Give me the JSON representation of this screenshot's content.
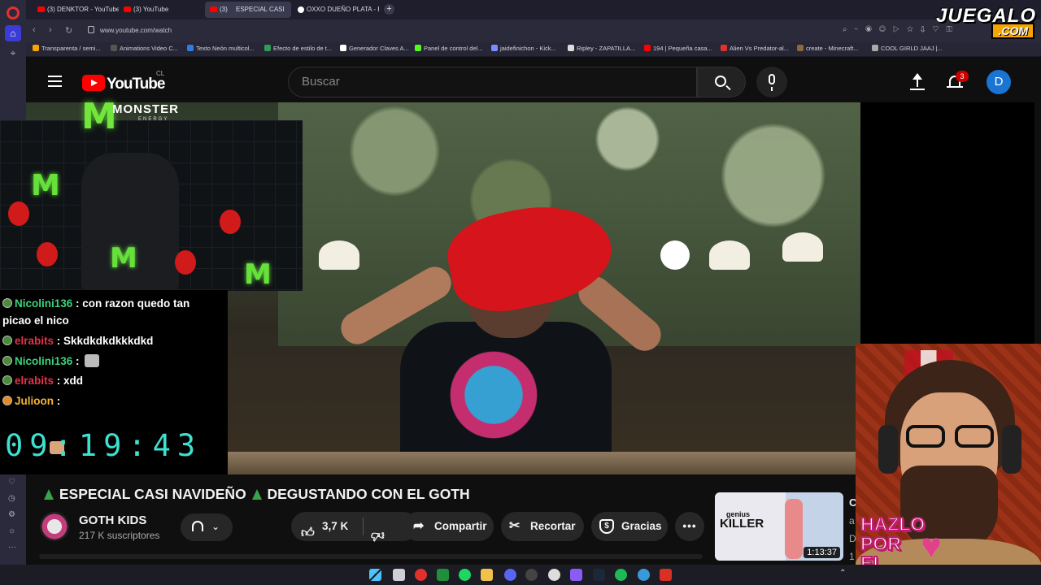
{
  "browser": {
    "tabs": [
      {
        "label": "(3) DENKTOR - YouTube",
        "active": false,
        "favicon": "youtube-icon"
      },
      {
        "label": "(3) YouTube",
        "active": false,
        "favicon": "youtube-icon"
      },
      {
        "label": "(3)  ESPECIAL CASI",
        "active": true,
        "favicon": "youtube-icon"
      },
      {
        "label": "OXXO DUEÑO PLATA - Bu",
        "active": false,
        "favicon": "google-icon"
      }
    ],
    "url": "www.youtube.com/watch",
    "bookmarks": [
      {
        "label": "Transparenta / semi...",
        "color": "#f6a400"
      },
      {
        "label": "Animations Video C...",
        "color": "#555555"
      },
      {
        "label": "Texto Neón multicol...",
        "color": "#2f7de1"
      },
      {
        "label": "Efecto de estilo de t...",
        "color": "#2f9d57"
      },
      {
        "label": "Generador Claves A...",
        "color": "#ffffff"
      },
      {
        "label": "Panel de control del...",
        "color": "#53fc18"
      },
      {
        "label": "jaidefinichon - Kick...",
        "color": "#7b8cff"
      },
      {
        "label": "Ripley - ZAPATILLA...",
        "color": "#dddddd"
      },
      {
        "label": "194 | Pequeña casa...",
        "color": "#ff0000"
      },
      {
        "label": "Alien Vs Predator-al...",
        "color": "#e2312d"
      },
      {
        "label": "create - Minecraft...",
        "color": "#8a6a3a"
      },
      {
        "label": "COOL GIRLD JAAJ |...",
        "color": "#aaaaaa"
      }
    ]
  },
  "watermark": {
    "top": "JUEGALO",
    "bottom": ".COM"
  },
  "youtube": {
    "logo_text": "YouTube",
    "country_code": "CL",
    "search_placeholder": "Buscar",
    "notifications_count": "3",
    "avatar_letter": "D",
    "video": {
      "title": "ESPECIAL CASI NAVIDEÑO",
      "title_rest": "DEGUSTANDO CON EL GOTH",
      "channel_name": "GOTH KIDS",
      "subscribers": "217 K suscriptores",
      "likes": "3,7 K",
      "share_label": "Compartir",
      "clip_label": "Recortar",
      "thanks_label": "Gracias",
      "more_label": "•••"
    },
    "recommended": {
      "thumb_text_top": "genius",
      "thumb_text": "KILLER",
      "duration": "1:13:37",
      "title_initial": "C",
      "line2": "a",
      "line3": "D",
      "line4": "1"
    }
  },
  "stream_overlay": {
    "sponsor": "MONSTER",
    "sponsor_sub": "ENERGY",
    "chat": [
      {
        "user": "Nicolini136",
        "user_color": "green",
        "message": " : con razon quedo tan picao el nico",
        "emote": ""
      },
      {
        "user": "elrabits",
        "user_color": "red",
        "message": " : Skkdkdkdkkkdkd",
        "emote": ""
      },
      {
        "user": "Nicolini136",
        "user_color": "green",
        "message": " : ",
        "emote": "emote-icon"
      },
      {
        "user": "elrabits",
        "user_color": "red",
        "message": " : xdd",
        "emote": ""
      },
      {
        "user": "Julioon",
        "user_color": "yellow",
        "message": " : ",
        "emote": "face-emote-icon"
      }
    ],
    "clock": "09:19:43",
    "cta": [
      "HAZLO",
      "POR",
      "EL"
    ]
  }
}
